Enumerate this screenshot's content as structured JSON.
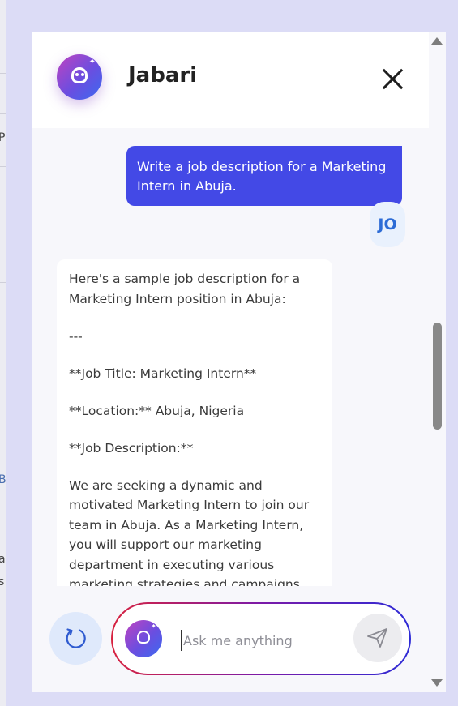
{
  "assistant": {
    "name": "Jabari"
  },
  "conversation": {
    "user_message": "Write a job description for a Marketing Intern in Abuja.",
    "user_initials": "JO",
    "bot_message_paragraphs": [
      "Here's a sample job description for a Marketing Intern position in Abuja:",
      "---",
      "**Job Title: Marketing Intern**",
      "**Location:** Abuja, Nigeria",
      "**Job Description:**",
      "We are seeking a dynamic and motivated Marketing Intern to join our team in Abuja. As a Marketing Intern, you will support our marketing department in executing various marketing strategies and campaigns."
    ]
  },
  "composer": {
    "placeholder": "Ask me anything"
  },
  "background": {
    "fragments": [
      "P",
      "B",
      "a",
      "s"
    ]
  },
  "colors": {
    "user_bubble": "#4349e6",
    "user_avatar_text": "#2d6cd6",
    "input_border_start": "#d8223f",
    "input_border_end": "#2e2bd6"
  }
}
